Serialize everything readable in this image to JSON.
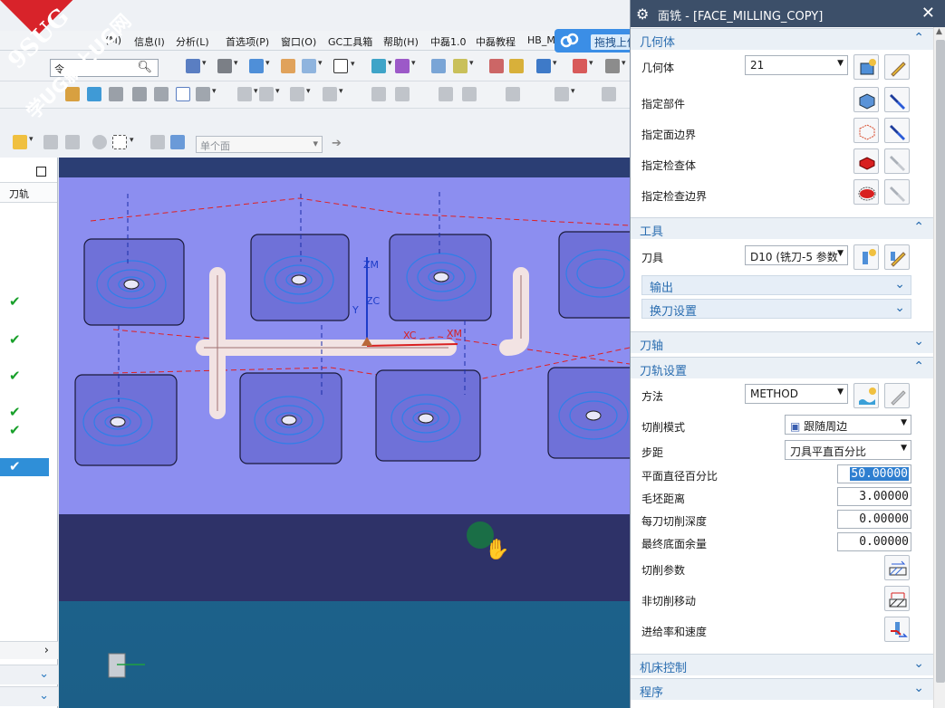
{
  "watermark": {
    "line1": "9SUG",
    "line2": "学UG就上UG网"
  },
  "menu": [
    "(M)",
    "信息(I)",
    "分析(L)",
    "首选项(P)",
    "窗口(O)",
    "GC工具箱",
    "帮助(H)",
    "中磊1.0",
    "中磊教程",
    "HB_M"
  ],
  "command_search": {
    "value": "令"
  },
  "selection_filter": {
    "value": "单个面"
  },
  "drag_upload": {
    "label": "拖拽上传"
  },
  "navigator": {
    "column_header": "刀轨"
  },
  "viewport": {
    "axis_labels": {
      "zm": "ZM",
      "zc": "ZC",
      "yc": "Y",
      "xc": "XC",
      "xm": "XM"
    }
  },
  "dialog": {
    "title": "面铣 - [FACE_MILLING_COPY]",
    "groups": {
      "geometry": "几何体",
      "tool": "工具",
      "output": "输出",
      "tool_change": "换刀设置",
      "tool_axis": "刀轴",
      "path_settings": "刀轨设置",
      "machine_control": "机床控制",
      "program": "程序"
    },
    "geometry": {
      "label": "几何体",
      "value": "21",
      "specify_part": "指定部件",
      "specify_face_boundary": "指定面边界",
      "specify_check_body": "指定检查体",
      "specify_check_boundary": "指定检查边界"
    },
    "tool": {
      "label": "刀具",
      "value": "D10 (铣刀-5 参数"
    },
    "path": {
      "method_label": "方法",
      "method_value": "METHOD",
      "cut_pattern_label": "切削模式",
      "cut_pattern_value": "跟随周边",
      "stepover_label": "步距",
      "stepover_value": "刀具平直百分比",
      "flat_diameter_pct_label": "平面直径百分比",
      "flat_diameter_pct_value": "50.00000",
      "blank_distance_label": "毛坯距离",
      "blank_distance_value": "3.00000",
      "depth_per_cut_label": "每刀切削深度",
      "depth_per_cut_value": "0.00000",
      "final_floor_stock_label": "最终底面余量",
      "final_floor_stock_value": "0.00000",
      "cutting_params": "切削参数",
      "non_cutting_moves": "非切削移动",
      "feeds_speeds": "进给率和速度"
    }
  },
  "colors": {
    "dialog_title_bg": "#3c4f69",
    "group_text": "#2a6db0",
    "plate": "#8c8ef0",
    "toolpath": "#2f7fe8",
    "check": "#18a02a",
    "watermark_red": "#d8232a"
  }
}
